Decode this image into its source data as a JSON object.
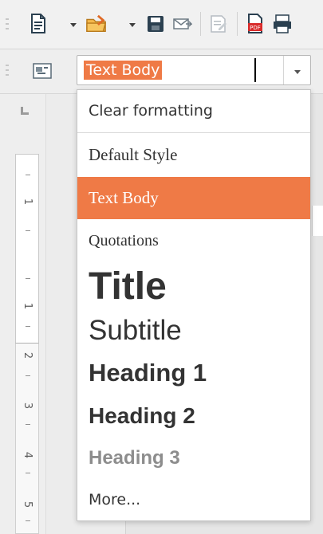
{
  "toolbar": {
    "icons": [
      "new-document-icon",
      "new-document-dropdown-icon",
      "open-folder-icon",
      "open-dropdown-icon",
      "save-icon",
      "email-document-icon",
      "edit-document-icon",
      "export-pdf-icon",
      "print-icon"
    ],
    "pdf_label": "PDF"
  },
  "style_box": {
    "value": "Text Body",
    "selected_color": "#ef7a46"
  },
  "styles_menu": {
    "items": [
      {
        "label": "Clear formatting"
      },
      {
        "label": "Default Style"
      },
      {
        "label": "Text Body"
      },
      {
        "label": "Quotations"
      },
      {
        "label": "Title"
      },
      {
        "label": "Subtitle"
      },
      {
        "label": "Heading 1"
      },
      {
        "label": "Heading 2"
      },
      {
        "label": "Heading 3"
      },
      {
        "label": "More..."
      }
    ]
  },
  "ruler": {
    "labels": [
      "1",
      "1",
      "2",
      "3",
      "4",
      "5"
    ]
  }
}
